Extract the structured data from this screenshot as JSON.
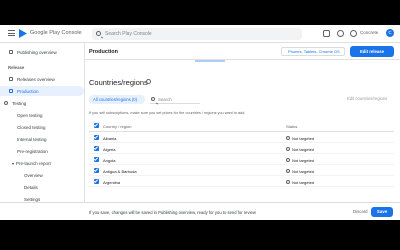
{
  "header": {
    "app_title": "Google Play Console",
    "search_placeholder": "Search Play Console",
    "account_name": "Concrete",
    "avatar_letter": "C"
  },
  "sidebar": {
    "app_name": "Publishing overview",
    "section": "Release",
    "items": [
      {
        "label": "Releases overview",
        "active": false
      },
      {
        "label": "Production",
        "active": true
      },
      {
        "label": "Testing",
        "active": false
      },
      {
        "label": "Open testing",
        "active": false
      },
      {
        "label": "Closed testing",
        "active": false
      },
      {
        "label": "Internal testing",
        "active": false
      },
      {
        "label": "Pre-registration",
        "active": false
      },
      {
        "label": "Pre-launch report",
        "active": false
      },
      {
        "label": "Overview",
        "active": false
      },
      {
        "label": "Details",
        "active": false
      },
      {
        "label": "Settings",
        "active": false
      }
    ]
  },
  "main": {
    "title": "Production",
    "device_filter": "Phones, Tablets, Chrome OS",
    "edit_release": "Edit release",
    "section_title": "Countries/regions",
    "filter_chip": "All countries/regions (0)",
    "filter_search": "Search",
    "edit_link": "Edit countries/regions",
    "info": "If you sell subscriptions, make sure you set prices for the countries / regions you want to add.",
    "columns": [
      "Country / region",
      "Status"
    ],
    "rows": [
      {
        "country": "Albania",
        "status": "Not targeted"
      },
      {
        "country": "Algeria",
        "status": "Not targeted"
      },
      {
        "country": "Angola",
        "status": "Not targeted"
      },
      {
        "country": "Antigua & Barbuda",
        "status": "Not targeted"
      },
      {
        "country": "Argentina",
        "status": "Not targeted"
      }
    ]
  },
  "footer": {
    "text": "If you save, changes will be saved in Publishing overview, ready for you to send for review",
    "discard": "Discard",
    "save": "Save"
  },
  "colors": {
    "accent": "#1a73e8",
    "active_bg": "#e8f0fe"
  }
}
